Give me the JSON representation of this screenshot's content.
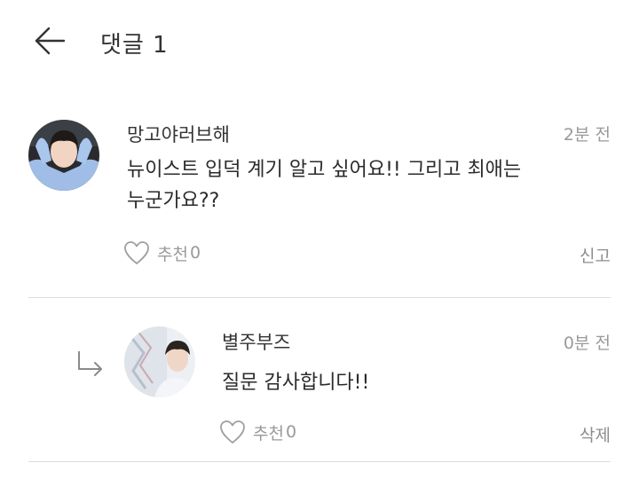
{
  "header": {
    "title": "댓글 1",
    "back_icon": "arrow-left-icon"
  },
  "comment": {
    "author": "망고야러브해",
    "time": "2분 전",
    "text_line1": "뉴이스트 입덕 계기 알고 싶어요!! 그리고 최애는",
    "text_line2": "누군가요??",
    "like_label": "추천",
    "like_count": "0",
    "action": "신고",
    "like_icon": "heart-outline-icon"
  },
  "reply": {
    "author": "별주부즈",
    "time": "0분 전",
    "text": "질문 감사합니다!!",
    "like_label": "추천",
    "like_count": "0",
    "action": "삭제",
    "indent_icon": "reply-arrow-icon",
    "like_icon": "heart-outline-icon"
  },
  "colors": {
    "text": "#2b2b2b",
    "muted": "#9a9a9a",
    "divider": "#dcdcdc"
  }
}
